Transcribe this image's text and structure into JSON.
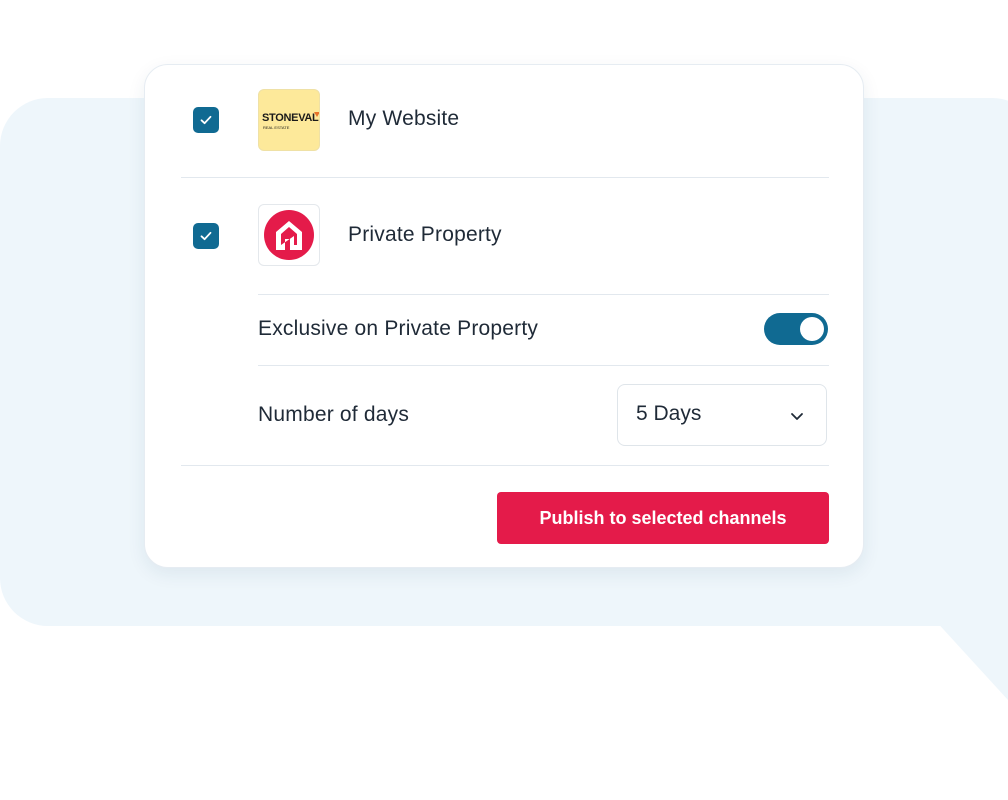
{
  "channels": [
    {
      "name": "My Website",
      "checked": true,
      "logo": {
        "icon": "stonevale-logo",
        "brand": "STONEVALE",
        "tagline": "REAL ESTATE",
        "bg": "#fde99a"
      }
    },
    {
      "name": "Private Property",
      "checked": true,
      "logo": {
        "icon": "private-property-logo",
        "bg": "#ffffff",
        "accent": "#e41b4a"
      }
    }
  ],
  "exclusive": {
    "label": "Exclusive on Private Property",
    "enabled": true
  },
  "days": {
    "label": "Number of days",
    "value": "5 Days"
  },
  "publish": {
    "label": "Publish to selected channels"
  },
  "colors": {
    "accent": "#106a92",
    "brand": "#e41b4a",
    "backdrop": "#eef6fb"
  }
}
